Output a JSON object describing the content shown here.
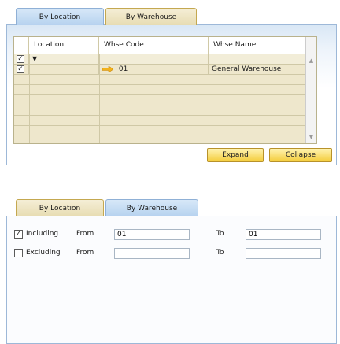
{
  "top_panel": {
    "tabs": [
      {
        "label": "By Location",
        "active": true
      },
      {
        "label": "By Warehouse",
        "active": false
      }
    ],
    "grid": {
      "columns": [
        "",
        "Location",
        "Whse Code",
        "Whse Name"
      ],
      "rows": [
        {
          "checked": true,
          "location_icon": "dropdown-triangle-icon",
          "whse_code": "",
          "whse_name": ""
        },
        {
          "checked": true,
          "location": "",
          "whse_code": "01",
          "whse_name": "General Warehouse"
        }
      ]
    },
    "buttons": {
      "expand": "Expand",
      "collapse": "Collapse"
    }
  },
  "bottom_panel": {
    "tabs": [
      {
        "label": "By Location",
        "active": false
      },
      {
        "label": "By Warehouse",
        "active": true
      }
    ],
    "including": {
      "checked": true,
      "label": "Including",
      "from_label": "From",
      "from_value": "01",
      "to_label": "To",
      "to_value": "01"
    },
    "excluding": {
      "checked": false,
      "label": "Excluding",
      "from_label": "From",
      "from_value": "",
      "to_label": "To",
      "to_value": ""
    }
  },
  "colors": {
    "accent_yellow": "#f4cd3c",
    "tab_blue": "#b6d2ef",
    "grid_bg": "#eee7cc",
    "arrow": "#f2b21c"
  }
}
